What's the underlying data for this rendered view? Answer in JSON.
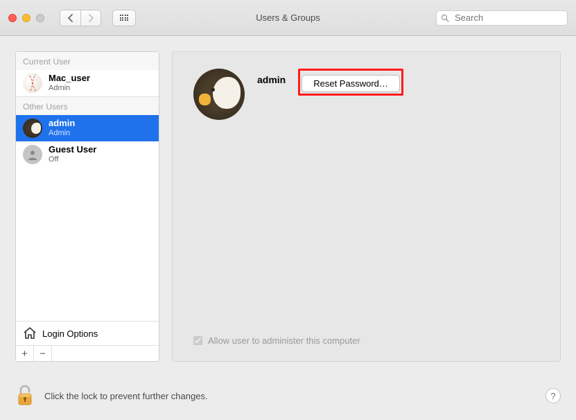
{
  "window": {
    "title": "Users & Groups"
  },
  "search": {
    "placeholder": "Search"
  },
  "sidebar": {
    "current_label": "Current User",
    "other_label": "Other Users",
    "current_user": {
      "name": "Mac_user",
      "role": "Admin"
    },
    "users": [
      {
        "name": "admin",
        "role": "Admin"
      },
      {
        "name": "Guest User",
        "role": "Off"
      }
    ],
    "login_options": "Login Options"
  },
  "main": {
    "selected_name": "admin",
    "reset_label": "Reset Password…",
    "admin_checkbox": "Allow user to administer this computer"
  },
  "footer": {
    "lock_text": "Click the lock to prevent further changes."
  }
}
